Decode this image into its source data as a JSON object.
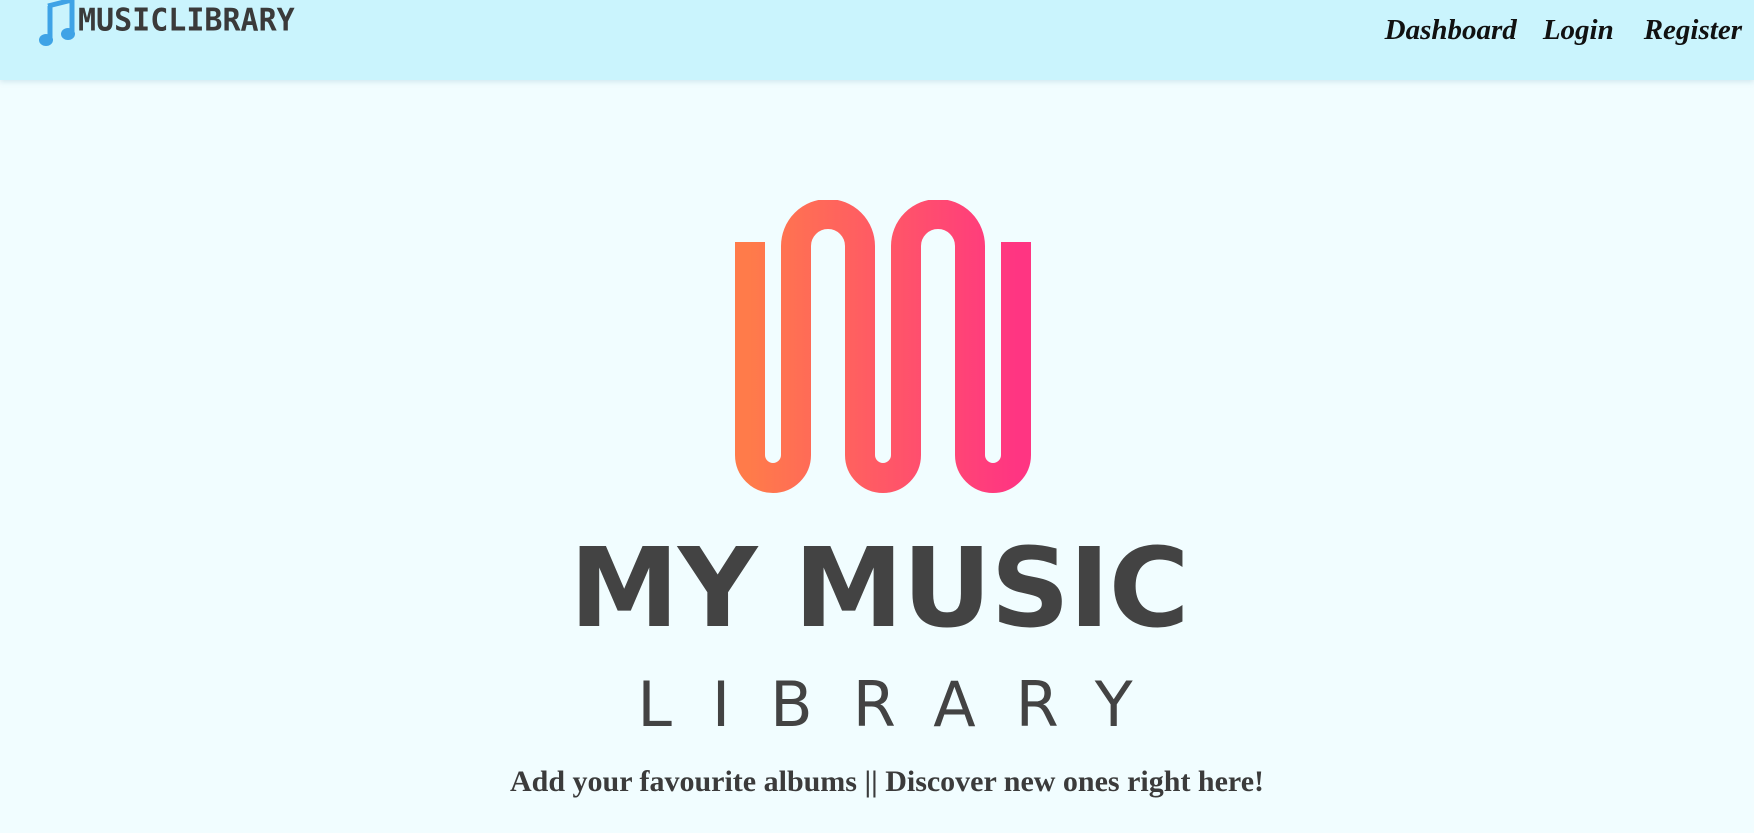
{
  "navbar": {
    "brand": {
      "icon": "music-note-icon",
      "text": "MUSICLIBRARY"
    },
    "links": [
      {
        "label": "Dashboard"
      },
      {
        "label": "Login"
      },
      {
        "label": "Register"
      }
    ]
  },
  "hero": {
    "logo_title": "MY MUSIC",
    "logo_subtitle": "LIBRARY",
    "tagline": "Add your favourite albums || Discover new ones right here!"
  },
  "colors": {
    "navbar_bg": "#caf4fd",
    "page_bg": "#f1fdff",
    "gradient_start": "#ff7b4a",
    "gradient_end": "#ff3582",
    "text_dark": "#434343",
    "brand_icon": "#3fa3e6"
  }
}
